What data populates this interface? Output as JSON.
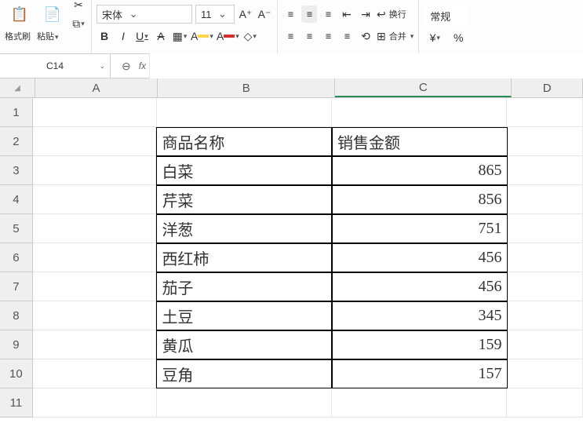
{
  "toolbar": {
    "format_painter": "格式刷",
    "paste": "粘贴",
    "font_name": "宋体",
    "font_size": "11",
    "bold": "B",
    "italic": "I",
    "underline": "U",
    "strike": "A",
    "wrap": "换行",
    "merge": "合并",
    "general": "常规",
    "currency": "¥",
    "percent": "%"
  },
  "formula_bar": {
    "name_box": "C14",
    "fx": "fx",
    "formula": ""
  },
  "columns": [
    "A",
    "B",
    "C",
    "D"
  ],
  "rows_visible": [
    "1",
    "2",
    "3",
    "4",
    "5",
    "6",
    "7",
    "8",
    "9",
    "10",
    "11"
  ],
  "chart_data": {
    "type": "table",
    "title": "",
    "headers": [
      "商品名称",
      "销售金额"
    ],
    "records": [
      {
        "name": "白菜",
        "amount": 865
      },
      {
        "name": "芹菜",
        "amount": 856
      },
      {
        "name": "洋葱",
        "amount": 751
      },
      {
        "name": "西红柿",
        "amount": 456
      },
      {
        "name": "茄子",
        "amount": 456
      },
      {
        "name": "土豆",
        "amount": 345
      },
      {
        "name": "黄瓜",
        "amount": 159
      },
      {
        "name": "豆角",
        "amount": 157
      }
    ]
  }
}
